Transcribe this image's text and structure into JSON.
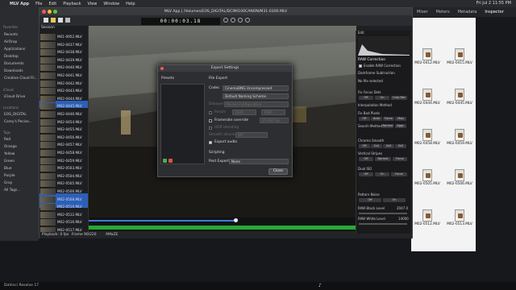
{
  "menubar": {
    "app": "MLV App",
    "items": [
      "File",
      "Edit",
      "Playback",
      "View",
      "Window",
      "Help"
    ],
    "clock": "Fri Jul 2  11:55 PM"
  },
  "resolve": {
    "tabs": [
      "Mixer",
      "Meters",
      "Metadata",
      "Inspector"
    ],
    "bottom": "DaVinci Resolve 17"
  },
  "finder_sidebar": {
    "favorites": [
      "Recents",
      "AirDrop",
      "Applications",
      "Desktop",
      "Documents",
      "Downloads",
      "Creative Cloud Fil..."
    ],
    "icloud_header": "iCloud",
    "icloud": [
      "iCloud Drive"
    ],
    "locations_header": "Locations",
    "locations": [
      "EOS_DIGITAL",
      "Corey's Pecise..."
    ],
    "tags_header": "Tags",
    "tags": [
      "Red",
      "Orange",
      "Yellow",
      "Green",
      "Blue",
      "Purple",
      "Gray",
      "All Tags..."
    ]
  },
  "window": {
    "title": "MLV App | /Volumes/EOS_DIGITAL/DCIM/100CANON/M31-0300.MLV",
    "timecode": "00:00:03.18"
  },
  "session": {
    "label": "Session",
    "files": [
      "M01-0952.MLV",
      "M02-0437.MLV",
      "M02-0438.MLV",
      "M02-0439.MLV",
      "M02-0440.MLV",
      "M02-0441.MLV",
      "M02-0442.MLV",
      "M02-0443.MLV",
      "M02-0444.MLV",
      "M02-0445.MLV",
      "M02-0446.MLV",
      "M02-0454.MLV",
      "M02-0455.MLV",
      "M02-0456.MLV",
      "M02-0457.MLV",
      "M02-0458.MLV",
      "M02-0459.MLV",
      "M02-0503.MLV",
      "M02-0504.MLV",
      "M02-0505.MLV",
      "M02-0506.MLV",
      "M02-0508.MLV",
      "M02-0510.MLV",
      "M02-0512.MLV",
      "M02-0516.MLV",
      "M02-0517.MLV"
    ]
  },
  "statusbar": {
    "playback": "Playback: 0 fps",
    "frame": "Frame 90/220",
    "debayer": "AMaZE"
  },
  "dialog": {
    "title": "Export Settings",
    "presets": "Presets",
    "file_export": "File Export",
    "codec_label": "Codec",
    "codec": "CinemaDNG Uncompressed",
    "naming": "Default Naming Scheme",
    "debayer_label": "Debayer",
    "debayer": "Reveal configuration",
    "resize": "Resize",
    "w": "1920",
    "h": "1080",
    "framerate": "Framerate override",
    "fps": "25.000 fps",
    "hdr": "HDR blending",
    "smooth": "Smooth aliasing",
    "smooth_val": "Off",
    "export_audio": "Export audio",
    "scripting": "Scripting",
    "post_export_label": "Post Export",
    "post_export": "None",
    "close": "Close"
  },
  "edit": {
    "header": "Edit",
    "raw": "RAW Correction",
    "enable": "Enable RAW Correction",
    "dark": "Darkframe Subtraction",
    "dark_val": "Off",
    "no_file": "No file selected",
    "focus": "Fix Focus Dots",
    "focus_opts": [
      "Off",
      "On",
      "Crop Rec"
    ],
    "interp": "Interpolation Method",
    "bad": "Fix Bad Pixels",
    "bad_opts": [
      "Off",
      "Auto",
      "Force",
      "Map"
    ],
    "search": "Search Method",
    "search_opts": [
      "Normal",
      "Aggr."
    ],
    "chroma": "Chroma Smooth",
    "chroma_opts": [
      "Off",
      "2x2",
      "3x3",
      "5x5"
    ],
    "vstripes": "Vertical Stripes",
    "vstripes_opts": [
      "Off",
      "Normal",
      "Force"
    ],
    "dual": "Dual ISO",
    "dual_opts": [
      "Off",
      "On",
      "Force"
    ],
    "pattern": "Pattern Noise",
    "pattern_opts": [
      "Off",
      "On"
    ],
    "black": "RAW Black Level",
    "black_val": "2047.0",
    "white": "RAW White Level",
    "white_val": "14000"
  },
  "right_files": [
    "M02-0412.MLV",
    "M02-0415.MLV",
    "M02-0444.MLV",
    "M02-0445.MLV",
    "M02-0458.MLV",
    "M02-0459.MLV",
    "M02-0505.MLV",
    "M02-0506.MLV",
    "M02-0512.MLV",
    "M02-0513.MLV",
    "M02-0517.MLV",
    "M02-0518.MLV"
  ]
}
